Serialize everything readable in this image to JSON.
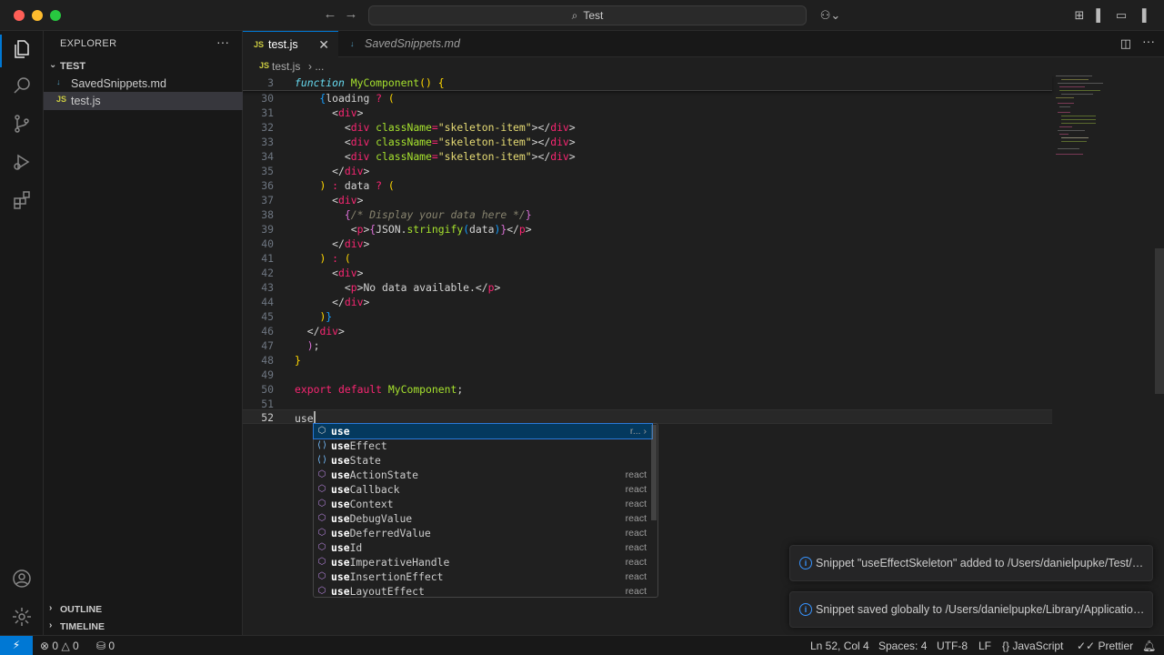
{
  "titlebar": {
    "search_label": "Test",
    "back_icon": "arrow-left-icon",
    "forward_icon": "arrow-right-icon"
  },
  "sidebar": {
    "title": "EXPLORER",
    "more": "···",
    "folder": "TEST",
    "files": [
      {
        "name": "SavedSnippets.md",
        "icon": "↓",
        "icon_color": "#519aba"
      },
      {
        "name": "test.js",
        "icon": "JS",
        "icon_color": "#cbcb41"
      }
    ],
    "outline": "OUTLINE",
    "timeline": "TIMELINE"
  },
  "tabs": [
    {
      "label": "test.js",
      "icon": "JS",
      "icon_color": "#cbcb41",
      "close": "✕"
    },
    {
      "label": "SavedSnippets.md",
      "icon": "↓",
      "icon_color": "#519aba"
    }
  ],
  "breadcrumb": {
    "icon": "JS",
    "file": "test.js",
    "sep": "› ..."
  },
  "editor": {
    "sticky_line_number": "3",
    "line_numbers": [
      "30",
      "31",
      "32",
      "33",
      "34",
      "35",
      "36",
      "37",
      "38",
      "39",
      "40",
      "41",
      "42",
      "43",
      "44",
      "45",
      "46",
      "47",
      "48",
      "49",
      "50",
      "51",
      "52"
    ],
    "typed_text": "use"
  },
  "suggest": {
    "items": [
      {
        "match": "use",
        "rest": "",
        "detail": "r... ›",
        "kind": "module"
      },
      {
        "match": "use",
        "rest": "Effect",
        "detail": "",
        "kind": "variable"
      },
      {
        "match": "use",
        "rest": "State",
        "detail": "",
        "kind": "variable"
      },
      {
        "match": "use",
        "rest": "ActionState",
        "detail": "react",
        "kind": "module"
      },
      {
        "match": "use",
        "rest": "Callback",
        "detail": "react",
        "kind": "module"
      },
      {
        "match": "use",
        "rest": "Context",
        "detail": "react",
        "kind": "module"
      },
      {
        "match": "use",
        "rest": "DebugValue",
        "detail": "react",
        "kind": "module"
      },
      {
        "match": "use",
        "rest": "DeferredValue",
        "detail": "react",
        "kind": "module"
      },
      {
        "match": "use",
        "rest": "Id",
        "detail": "react",
        "kind": "module"
      },
      {
        "match": "use",
        "rest": "ImperativeHandle",
        "detail": "react",
        "kind": "module"
      },
      {
        "match": "use",
        "rest": "InsertionEffect",
        "detail": "react",
        "kind": "module"
      },
      {
        "match": "use",
        "rest": "LayoutEffect",
        "detail": "react",
        "kind": "module"
      }
    ]
  },
  "notifications": [
    {
      "message": "Snippet \"useEffectSkeleton\" added to /Users/danielpupke/Test/SavedSnippets.md"
    },
    {
      "message": "Snippet saved globally to /Users/danielpupke/Library/Application Support/Code/User/snippets"
    }
  ],
  "statusbar": {
    "errors": "0",
    "warnings": "0",
    "ports": "0",
    "position": "Ln 52, Col 4",
    "spaces": "Spaces: 4",
    "encoding": "UTF-8",
    "eol": "LF",
    "language": "JavaScript",
    "formatter": "Prettier"
  },
  "colors": {
    "accent": "#0078d4",
    "info": "#3794ff"
  }
}
